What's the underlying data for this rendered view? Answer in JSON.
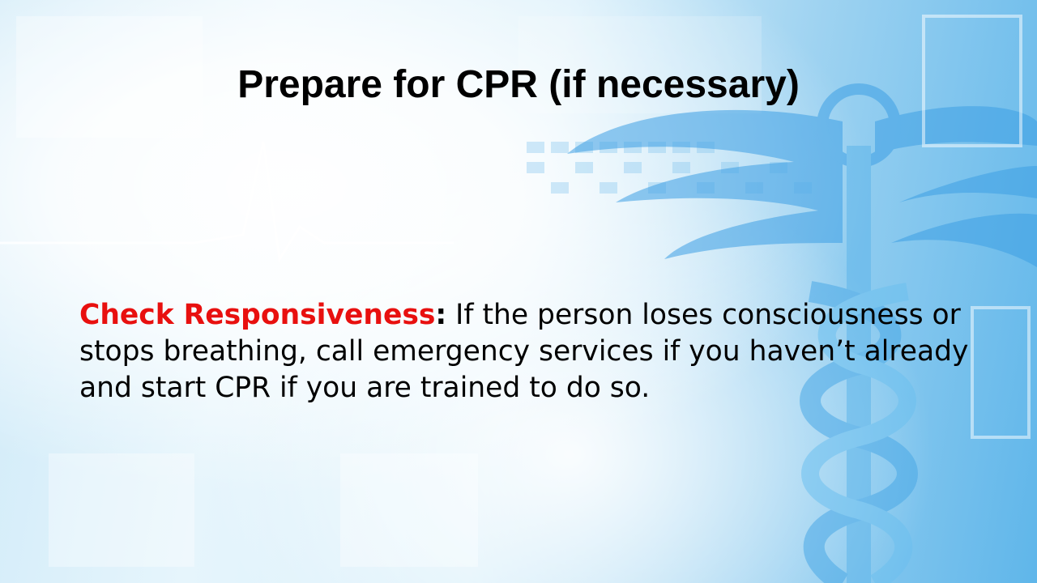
{
  "slide": {
    "title": "Prepare for CPR (if necessary)",
    "point": {
      "term": "Check Responsiveness",
      "separator": ":",
      "text": " If the person loses consciousness or stops breathing, call emergency services if you haven’t already and start CPR if you are trained to do so."
    }
  },
  "colors": {
    "title": "#000000",
    "term": "#e8100f",
    "body": "#000000",
    "accent_blue": "#2e8fd9"
  },
  "background": {
    "theme": "medical",
    "icon": "caduceus-icon"
  }
}
